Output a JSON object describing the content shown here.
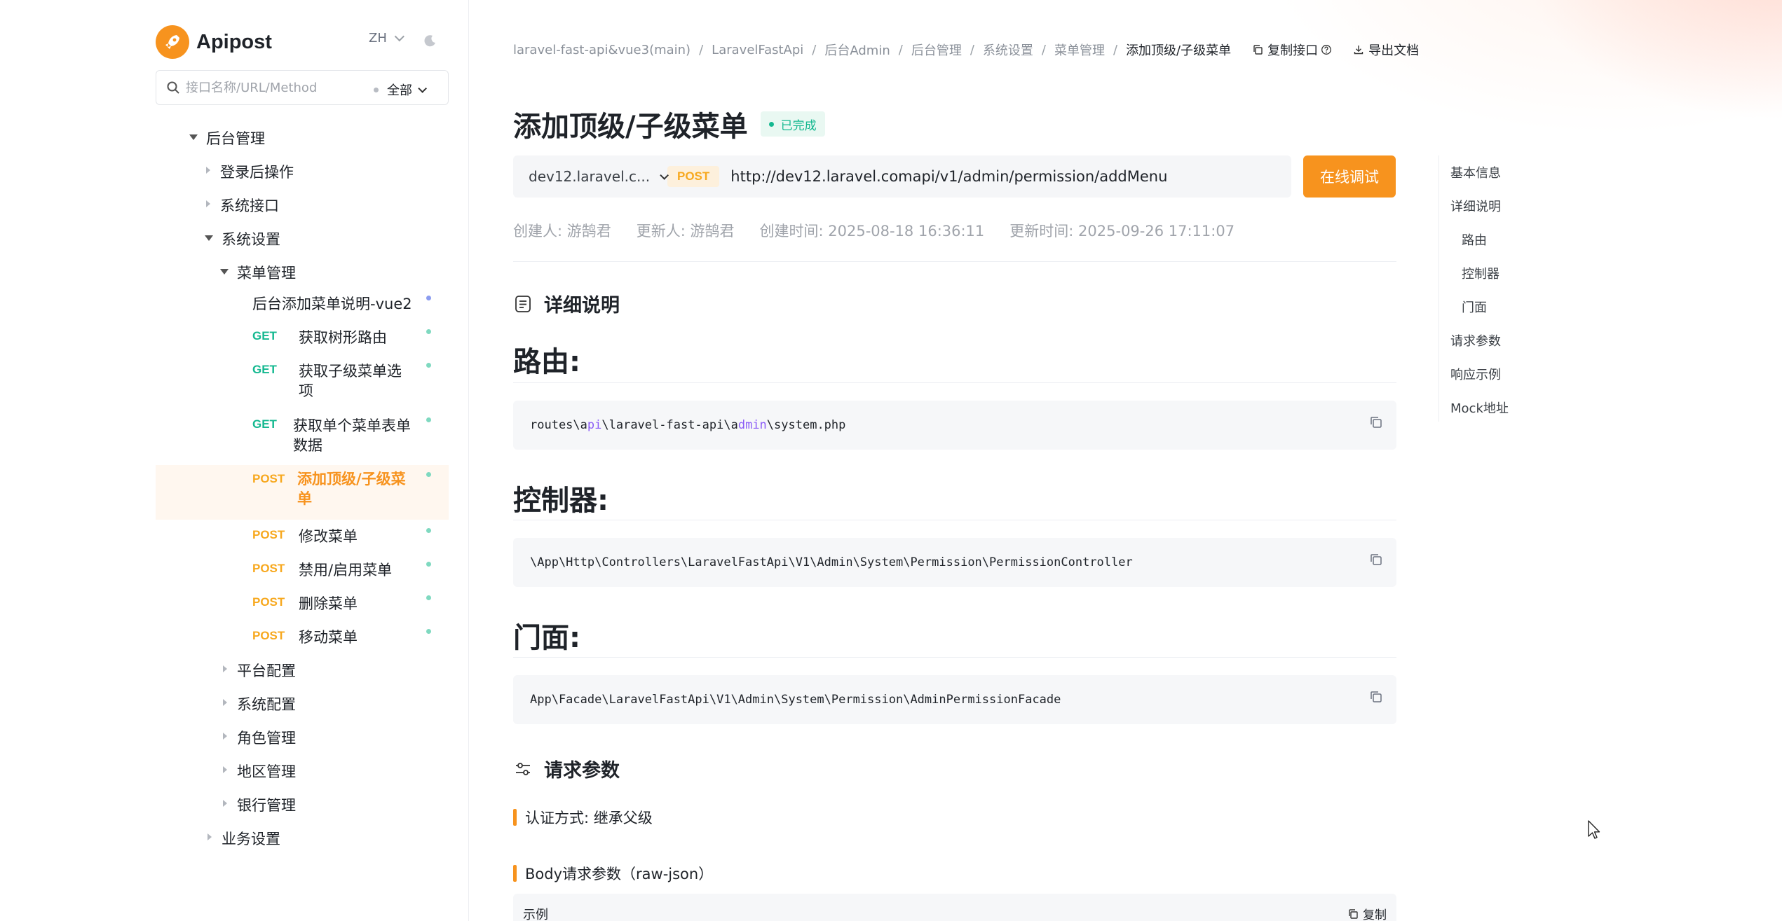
{
  "brand": {
    "name": "Apipost",
    "logo_icon": "rocket-icon",
    "accent": "#f7931e"
  },
  "header": {
    "lang": "ZH"
  },
  "search": {
    "placeholder": "接口名称/URL/Method",
    "filter_label": "全部"
  },
  "tree": {
    "folders": [
      {
        "label": "后台管理",
        "expanded": true
      },
      {
        "label": "登录后操作",
        "expanded": false
      },
      {
        "label": "系统接口",
        "expanded": false
      },
      {
        "label": "系统设置",
        "expanded": true
      },
      {
        "label": "菜单管理",
        "expanded": true
      }
    ],
    "doc_item": {
      "label": "后台添加菜单说明-vue2"
    },
    "apis": [
      {
        "method": "GET",
        "name_line1": "获取树形路由",
        "name_line2": ""
      },
      {
        "method": "GET",
        "name_line1": "获取子级菜单选",
        "name_line2": "项"
      },
      {
        "method": "GET",
        "name_line1": "获取单个菜单表单",
        "name_line2": "数据"
      },
      {
        "method": "POST",
        "name_line1": "添加顶级/子级菜",
        "name_line2": "单",
        "active": true
      },
      {
        "method": "POST",
        "name_line1": "修改菜单",
        "name_line2": ""
      },
      {
        "method": "POST",
        "name_line1": "禁用/启用菜单",
        "name_line2": ""
      },
      {
        "method": "POST",
        "name_line1": "删除菜单",
        "name_line2": ""
      },
      {
        "method": "POST",
        "name_line1": "移动菜单",
        "name_line2": ""
      }
    ],
    "siblings": [
      "平台配置",
      "系统配置",
      "角色管理",
      "地区管理",
      "银行管理"
    ],
    "root_sibling": "业务设置"
  },
  "breadcrumb": {
    "items": [
      "laravel-fast-api&vue3(main)",
      "LaravelFastApi",
      "后台Admin",
      "后台管理",
      "系统设置",
      "菜单管理",
      "添加顶级/子级菜单"
    ],
    "copy_label": "复制接口",
    "export_label": "导出文档"
  },
  "main": {
    "title": "添加顶级/子级菜单",
    "status": "已完成",
    "env": "dev12.laravel.c...",
    "method": "POST",
    "url": "http://dev12.laravel.comapi/v1/admin/permission/addMenu",
    "debug_label": "在线调试",
    "creator": "创建人: 游鹄君",
    "updater": "更新人: 游鹄君",
    "created_at": "创建时间: 2025-08-18 16:36:11",
    "updated_at": "更新时间: 2025-09-26 17:11:07",
    "detail_heading": "详细说明",
    "route_heading": "路由:",
    "route_code": {
      "p1": "routes\\a",
      "p2": "pi",
      "p3": "\\laravel-fast-api\\a",
      "p4": "dmin",
      "p5": "\\system.php"
    },
    "controller_heading": "控制器:",
    "controller_code": "\\App\\Http\\Controllers\\LaravelFastApi\\V1\\Admin\\System\\Permission\\PermissionController",
    "facade_heading": "门面:",
    "facade_code": "App\\Facade\\LaravelFastApi\\V1\\Admin\\System\\Permission\\AdminPermissionFacade",
    "params_heading": "请求参数",
    "auth_label": "认证方式: 继承父级",
    "body_label": "Body请求参数（raw-json）",
    "example_label": "示例",
    "example_copy": "复制"
  },
  "toc": {
    "items": [
      "基本信息",
      "详细说明",
      "路由",
      "控制器",
      "门面",
      "请求参数",
      "响应示例",
      "Mock地址"
    ]
  },
  "colors": {
    "get": "#14b890",
    "post": "#f7a81e",
    "done": "#14b890",
    "doc_dot": "#8b9cf0",
    "api_dot": "#7fd9c0"
  }
}
